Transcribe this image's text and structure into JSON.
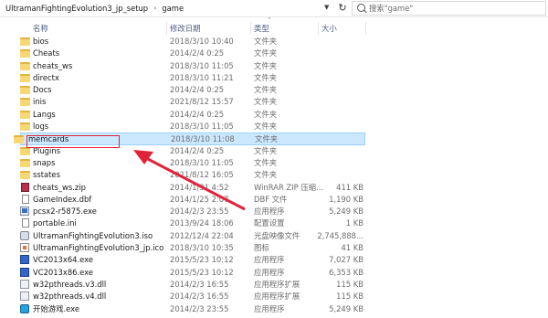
{
  "address": {
    "path": [
      "UltramanFightingEvolution3_jp_setup",
      "game"
    ],
    "separator": "›"
  },
  "search": {
    "placeholder": "搜索\"game\""
  },
  "columns": {
    "name": "名称",
    "date": "修改日期",
    "type": "类型",
    "size": "大小"
  },
  "files": [
    {
      "name": "bios",
      "date": "2018/3/10 10:40",
      "type": "文件夹",
      "size": "",
      "icon": "folder-icon"
    },
    {
      "name": "Cheats",
      "date": "2014/2/4 0:25",
      "type": "文件夹",
      "size": "",
      "icon": "folder-icon"
    },
    {
      "name": "cheats_ws",
      "date": "2018/3/10 11:05",
      "type": "文件夹",
      "size": "",
      "icon": "folder-icon"
    },
    {
      "name": "directx",
      "date": "2018/3/10 11:21",
      "type": "文件夹",
      "size": "",
      "icon": "folder-icon"
    },
    {
      "name": "Docs",
      "date": "2014/2/4 0:25",
      "type": "文件夹",
      "size": "",
      "icon": "folder-icon"
    },
    {
      "name": "inis",
      "date": "2021/8/12 15:57",
      "type": "文件夹",
      "size": "",
      "icon": "folder-icon"
    },
    {
      "name": "Langs",
      "date": "2014/2/4 0:25",
      "type": "文件夹",
      "size": "",
      "icon": "folder-icon"
    },
    {
      "name": "logs",
      "date": "2018/3/10 11:05",
      "type": "文件夹",
      "size": "",
      "icon": "folder-icon"
    },
    {
      "name": "memcards",
      "date": "2018/3/10 11:08",
      "type": "文件夹",
      "size": "",
      "icon": "folder-icon",
      "selected": true
    },
    {
      "name": "Plugins",
      "date": "2014/2/4 0:25",
      "type": "文件夹",
      "size": "",
      "icon": "folder-icon"
    },
    {
      "name": "snaps",
      "date": "2018/3/10 11:05",
      "type": "文件夹",
      "size": "",
      "icon": "folder-icon"
    },
    {
      "name": "sstates",
      "date": "2021/8/12 16:05",
      "type": "文件夹",
      "size": "",
      "icon": "folder-icon"
    },
    {
      "name": "cheats_ws.zip",
      "date": "2014/1/31 4:52",
      "type": "WinRAR ZIP 压缩...",
      "size": "411 KB",
      "icon": "zip-icon"
    },
    {
      "name": "GameIndex.dbf",
      "date": "2014/1/25 2:07",
      "type": "DBF 文件",
      "size": "1,190 KB",
      "icon": "file-icon"
    },
    {
      "name": "pcsx2-r5875.exe",
      "date": "2014/2/3 23:55",
      "type": "应用程序",
      "size": "5,249 KB",
      "icon": "exe-icon"
    },
    {
      "name": "portable.ini",
      "date": "2013/9/24 18:06",
      "type": "配置设置",
      "size": "1 KB",
      "icon": "file-icon"
    },
    {
      "name": "UltramanFightingEvolution3.iso",
      "date": "2012/12/4 22:04",
      "type": "光盘映像文件",
      "size": "2,745,888...",
      "icon": "iso-icon"
    },
    {
      "name": "UltramanFightingEvolution3_jp.ico",
      "date": "2018/3/10 10:35",
      "type": "图标",
      "size": "41 KB",
      "icon": "ico-icon"
    },
    {
      "name": "VC2013x64.exe",
      "date": "2015/5/23 10:12",
      "type": "应用程序",
      "size": "7,027 KB",
      "icon": "vc-icon"
    },
    {
      "name": "VC2013x86.exe",
      "date": "2015/5/23 10:12",
      "type": "应用程序",
      "size": "6,353 KB",
      "icon": "vc-icon"
    },
    {
      "name": "w32pthreads.v3.dll",
      "date": "2014/2/3 16:55",
      "type": "应用程序扩展",
      "size": "115 KB",
      "icon": "dll-icon"
    },
    {
      "name": "w32pthreads.v4.dll",
      "date": "2014/2/3 16:55",
      "type": "应用程序扩展",
      "size": "115 KB",
      "icon": "dll-icon"
    },
    {
      "name": "开始游戏.exe",
      "date": "2014/2/3 23:55",
      "type": "应用程序",
      "size": "5,249 KB",
      "icon": "game-icon"
    }
  ],
  "colors": {
    "selection_bg": "#cce8ff",
    "selection_border": "#99d1ff",
    "annotation": "#e0233b",
    "folder": "#f8d775"
  }
}
